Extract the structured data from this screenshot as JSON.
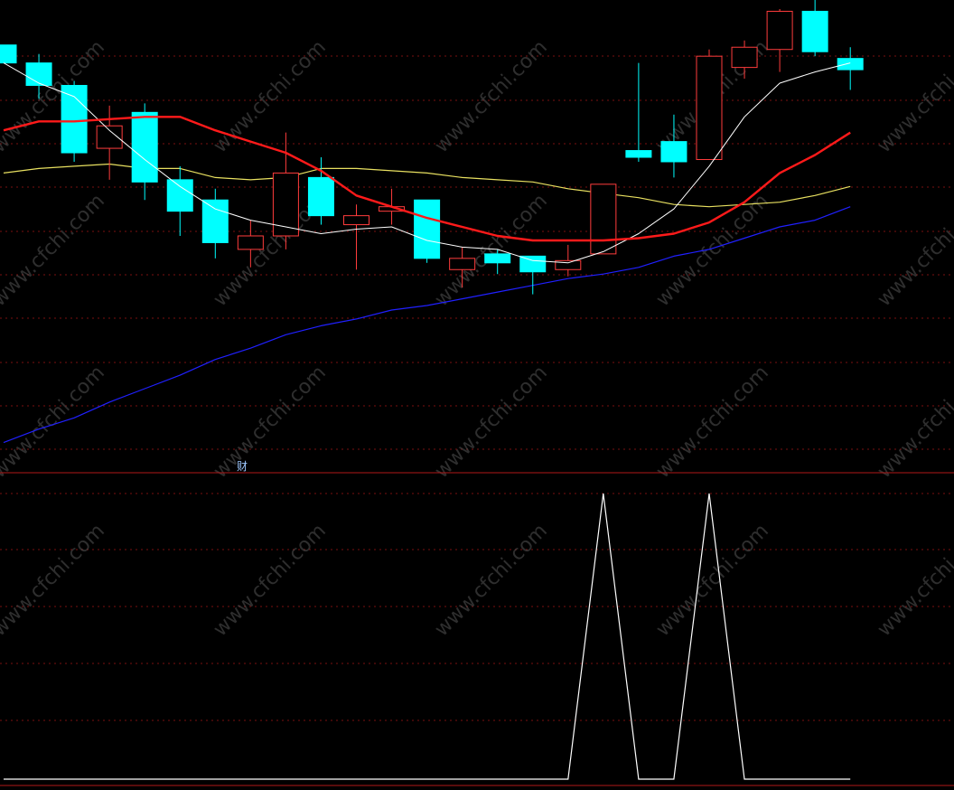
{
  "watermark": "www.cfchi.com",
  "marker_label": "财",
  "colors": {
    "background": "#000000",
    "up_candle": "#ff3c3c",
    "down_candle": "#00ffff",
    "grid": "#7a1010",
    "ma5": "#ffffff",
    "ma10": "#ff1a1a",
    "ma20": "#e8e060",
    "ma60": "#2020ff",
    "indicator": "#ffffff",
    "divider": "#b01818"
  },
  "chart_data": [
    {
      "type": "candlestick",
      "title": "",
      "xlabel": "",
      "ylabel": "",
      "grid": true,
      "ylim": [
        0,
        100
      ],
      "candles": [
        {
          "open": 92.0,
          "high": 92.0,
          "close": 88.0,
          "low": 88.0
        },
        {
          "open": 88.0,
          "high": 90.0,
          "close": 83.0,
          "low": 80.0
        },
        {
          "open": 83.0,
          "high": 84.0,
          "close": 68.0,
          "low": 66.0
        },
        {
          "open": 69.0,
          "high": 78.5,
          "close": 74.0,
          "low": 62.0
        },
        {
          "open": 77.0,
          "high": 79.0,
          "close": 61.5,
          "low": 57.5
        },
        {
          "open": 62.0,
          "high": 65.0,
          "close": 55.0,
          "low": 49.5
        },
        {
          "open": 57.5,
          "high": 60.0,
          "close": 48.0,
          "low": 44.5
        },
        {
          "open": 46.5,
          "high": 53.0,
          "close": 49.5,
          "low": 42.5
        },
        {
          "open": 49.5,
          "high": 72.5,
          "close": 63.5,
          "low": 46.5
        },
        {
          "open": 62.5,
          "high": 67.0,
          "close": 54.0,
          "low": 52.0
        },
        {
          "open": 52.0,
          "high": 56.5,
          "close": 54.0,
          "low": 42.0
        },
        {
          "open": 55.0,
          "high": 60.0,
          "close": 56.0,
          "low": 52.0
        },
        {
          "open": 57.5,
          "high": 57.5,
          "close": 44.5,
          "low": 43.5
        },
        {
          "open": 42.0,
          "high": 47.0,
          "close": 44.5,
          "low": 38.0
        },
        {
          "open": 45.5,
          "high": 46.5,
          "close": 43.5,
          "low": 41.0
        },
        {
          "open": 45.0,
          "high": 45.0,
          "close": 41.5,
          "low": 36.5
        },
        {
          "open": 42.0,
          "high": 47.5,
          "close": 44.0,
          "low": 40.5
        },
        {
          "open": 45.5,
          "high": 61.0,
          "close": 61.0,
          "low": 45.5
        },
        {
          "open": 68.5,
          "high": 88.0,
          "close": 67.0,
          "low": 66.0
        },
        {
          "open": 70.5,
          "high": 76.5,
          "close": 66.0,
          "low": 62.5
        },
        {
          "open": 66.5,
          "high": 91.0,
          "close": 89.5,
          "low": 66.5
        },
        {
          "open": 87.0,
          "high": 93.0,
          "close": 91.5,
          "low": 84.5
        },
        {
          "open": 91.0,
          "high": 100.0,
          "close": 99.5,
          "low": 86.0
        },
        {
          "open": 99.5,
          "high": 106.0,
          "close": 90.5,
          "low": 89.5
        },
        {
          "open": 89.0,
          "high": 91.5,
          "close": 86.5,
          "low": 82.0
        }
      ],
      "moving_averages": [
        {
          "key": "ma5",
          "values": [
            88.0,
            83.5,
            80.5,
            73.0,
            66.5,
            60.5,
            55.5,
            53.0,
            51.5,
            50.0,
            51.0,
            51.5,
            48.5,
            47.0,
            46.5,
            44.0,
            43.5,
            46.0,
            50.0,
            55.5,
            65.0,
            76.0,
            83.5,
            86.0,
            88.0
          ]
        },
        {
          "key": "ma10",
          "values": [
            73.0,
            75.0,
            75.0,
            75.5,
            76.0,
            76.0,
            73.0,
            70.5,
            68.0,
            64.0,
            58.5,
            56.0,
            53.5,
            51.5,
            49.5,
            48.5,
            48.5,
            48.5,
            49.0,
            50.0,
            52.5,
            57.0,
            63.5,
            67.5,
            72.5
          ]
        },
        {
          "key": "ma20",
          "values": [
            63.5,
            64.5,
            65.0,
            65.5,
            64.5,
            64.5,
            62.5,
            62.0,
            62.5,
            64.5,
            64.5,
            64.0,
            63.5,
            62.5,
            62.0,
            61.5,
            60.0,
            59.0,
            58.0,
            56.5,
            56.0,
            56.5,
            57.0,
            58.5,
            60.5
          ]
        },
        {
          "key": "ma60",
          "values": [
            3.5,
            6.5,
            9.0,
            12.5,
            15.5,
            18.5,
            22.0,
            24.5,
            27.5,
            29.5,
            31.0,
            33.0,
            34.0,
            35.5,
            37.0,
            38.5,
            40.0,
            41.0,
            42.5,
            45.0,
            46.5,
            49.0,
            51.5,
            53.0,
            56.0
          ]
        }
      ]
    },
    {
      "type": "line",
      "title": "",
      "xlabel": "",
      "ylabel": "",
      "grid": true,
      "ylim": [
        0,
        1
      ],
      "values": [
        0,
        0,
        0,
        0,
        0,
        0,
        0,
        0,
        0,
        0,
        0,
        0,
        0,
        0,
        0,
        0,
        0,
        1,
        0,
        0,
        1,
        0,
        0,
        0,
        0
      ]
    }
  ]
}
